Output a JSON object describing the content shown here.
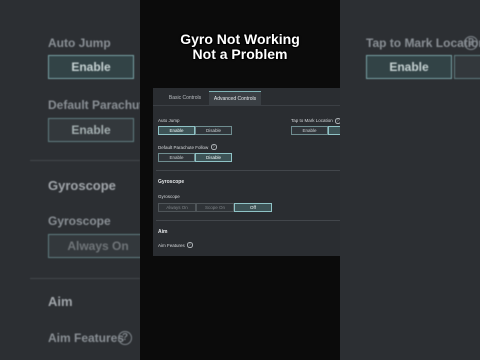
{
  "caption": {
    "line1": "Gyro Not Working",
    "line2": "Not a Problem"
  },
  "tabs": [
    {
      "label": "Basic Controls",
      "active": false
    },
    {
      "label": "Advanced Controls",
      "active": true
    }
  ],
  "settings": {
    "auto_jump": {
      "label": "Auto Jump",
      "options": [
        "Enable",
        "Disable"
      ],
      "selected": "Enable"
    },
    "tap_to_mark": {
      "label": "Tap to Mark Location",
      "options": [
        "Enable",
        "Disable"
      ],
      "selected": "Enable"
    },
    "default_parachute": {
      "label": "Default Parachute Follow",
      "options": [
        "Enable",
        "Disable"
      ],
      "selected": "Disable"
    }
  },
  "gyroscope": {
    "section_title": "Gyroscope",
    "label": "Gyroscope",
    "options": [
      "Always On",
      "Scope On",
      "Off"
    ],
    "selected": "Off"
  },
  "aim": {
    "section_title": "Aim",
    "features_label": "Aim Features"
  },
  "background": {
    "auto_jump": "Auto Jump",
    "enable": "Enable",
    "default_parachute": "Default Parachute F",
    "gyroscope_section": "Gyroscope",
    "gyroscope": "Gyroscope",
    "always_on": "Always On",
    "aim": "Aim",
    "aim_features": "Aim Features",
    "tap_to_mark": "Tap to Mark Location"
  },
  "colors": {
    "accent": "#8fc3c6",
    "panel": "#2a2d31",
    "text": "#d6d9dc"
  }
}
